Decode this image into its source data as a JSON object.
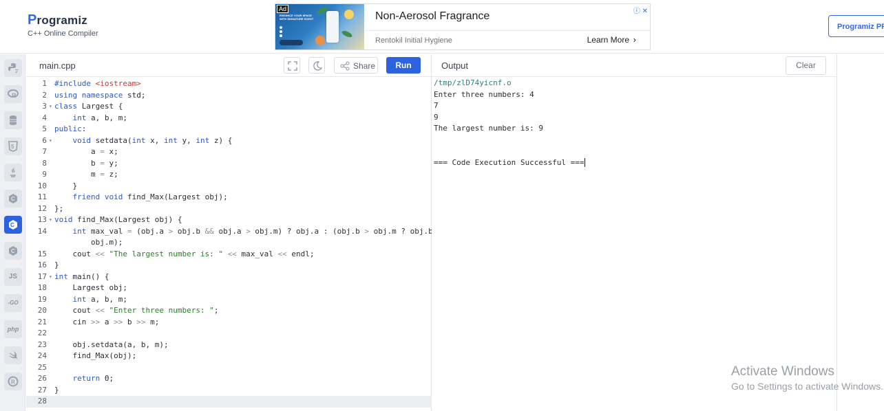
{
  "header": {
    "logo_text": "rogramiz",
    "logo_p": "P",
    "logo_subtitle": "C++ Online Compiler",
    "pro_button": "Programiz PRO"
  },
  "ad": {
    "badge": "Ad",
    "title": "Non-Aerosol Fragrance",
    "advertiser": "Rentokil Initial Hygiene",
    "cta": "Learn More",
    "cta_chevron": "›",
    "choices_icons": "ⓘ ✕",
    "image_text": "ENHANCE YOUR SPACE WITH SIGNATURE SCENT"
  },
  "sidebar": {
    "items": [
      {
        "name": "python",
        "glyph": "py"
      },
      {
        "name": "r",
        "glyph": "R"
      },
      {
        "name": "sql",
        "glyph": "db"
      },
      {
        "name": "html",
        "glyph": "5"
      },
      {
        "name": "java",
        "glyph": "java"
      },
      {
        "name": "c",
        "glyph": "C"
      },
      {
        "name": "cpp",
        "glyph": "C"
      },
      {
        "name": "csharp",
        "glyph": "C"
      },
      {
        "name": "javascript",
        "glyph": "JS"
      },
      {
        "name": "go",
        "glyph": "-GO"
      },
      {
        "name": "php",
        "glyph": "php"
      },
      {
        "name": "swift",
        "glyph": "swift"
      },
      {
        "name": "rust",
        "glyph": "R"
      }
    ],
    "active": "cpp"
  },
  "editor": {
    "filename": "main.cpp",
    "share_label": "Share",
    "run_label": "Run",
    "lines": [
      {
        "n": "1",
        "fold": "",
        "html": "<span class=\"kw\">#include</span> <span class=\"inc\">&lt;iostream&gt;</span>"
      },
      {
        "n": "2",
        "fold": "",
        "html": "<span class=\"kw\">using</span> <span class=\"kw\">namespace</span> std;"
      },
      {
        "n": "3",
        "fold": "▾",
        "html": "<span class=\"kw\">class</span> Largest {"
      },
      {
        "n": "4",
        "fold": "",
        "html": "    <span class=\"kw\">int</span> a, b, m;"
      },
      {
        "n": "5",
        "fold": "",
        "html": "<span class=\"kw\">public</span>:"
      },
      {
        "n": "6",
        "fold": "▾",
        "html": "    <span class=\"kw\">void</span> setdata(<span class=\"kw\">int</span> x, <span class=\"kw\">int</span> y, <span class=\"kw\">int</span> z) {"
      },
      {
        "n": "7",
        "fold": "",
        "html": "        a <span class=\"op\">=</span> x;"
      },
      {
        "n": "8",
        "fold": "",
        "html": "        b <span class=\"op\">=</span> y;"
      },
      {
        "n": "9",
        "fold": "",
        "html": "        m <span class=\"op\">=</span> z;"
      },
      {
        "n": "10",
        "fold": "",
        "html": "    }"
      },
      {
        "n": "11",
        "fold": "",
        "html": "    <span class=\"kw\">friend</span> <span class=\"kw\">void</span> find_Max(Largest obj);"
      },
      {
        "n": "12",
        "fold": "",
        "html": "};"
      },
      {
        "n": "13",
        "fold": "▾",
        "html": "<span class=\"kw\">void</span> find_Max(Largest obj) {"
      },
      {
        "n": "14",
        "fold": "",
        "html": "    <span class=\"kw\">int</span> max_val <span class=\"op\">=</span> (obj.a <span class=\"op\">&gt;</span> obj.b <span class=\"op\">&amp;&amp;</span> obj.a <span class=\"op\">&gt;</span> obj.m) ? obj.a : (obj.b <span class=\"op\">&gt;</span> obj.m ? obj.b :"
      },
      {
        "n": "",
        "fold": "",
        "html": "        obj.m);"
      },
      {
        "n": "15",
        "fold": "",
        "html": "    cout <span class=\"op\">&lt;&lt;</span> <span class=\"str\">\"The largest number is: \"</span> <span class=\"op\">&lt;&lt;</span> max_val <span class=\"op\">&lt;&lt;</span> endl;"
      },
      {
        "n": "16",
        "fold": "",
        "html": "}"
      },
      {
        "n": "17",
        "fold": "▾",
        "html": "<span class=\"kw\">int</span> main() {"
      },
      {
        "n": "18",
        "fold": "",
        "html": "    Largest obj;"
      },
      {
        "n": "19",
        "fold": "",
        "html": "    <span class=\"kw\">int</span> a, b, m;"
      },
      {
        "n": "20",
        "fold": "",
        "html": "    cout <span class=\"op\">&lt;&lt;</span> <span class=\"str\">\"Enter three numbers: \"</span>;"
      },
      {
        "n": "21",
        "fold": "",
        "html": "    cin <span class=\"op\">&gt;&gt;</span> a <span class=\"op\">&gt;&gt;</span> b <span class=\"op\">&gt;&gt;</span> m;"
      },
      {
        "n": "22",
        "fold": "",
        "html": ""
      },
      {
        "n": "23",
        "fold": "",
        "html": "    obj.setdata(a, b, m);"
      },
      {
        "n": "24",
        "fold": "",
        "html": "    find_Max(obj);"
      },
      {
        "n": "25",
        "fold": "",
        "html": ""
      },
      {
        "n": "26",
        "fold": "",
        "html": "    <span class=\"kw\">return</span> 0;"
      },
      {
        "n": "27",
        "fold": "",
        "html": "}"
      },
      {
        "n": "28",
        "fold": "",
        "html": ""
      }
    ],
    "current_line": "28"
  },
  "output": {
    "title": "Output",
    "clear_label": "Clear",
    "lines": [
      "/tmp/zlD74yicnf.o",
      "Enter three numbers: 4",
      "7",
      "9",
      "The largest number is: 9",
      "",
      "",
      "=== Code Execution Successful ==="
    ]
  },
  "watermark": {
    "line1": "Activate Windows",
    "line2": "Go to Settings to activate Windows."
  },
  "colors": {
    "accent": "#2e63df",
    "keyword": "#2e58c9",
    "string": "#2b7d2b",
    "include": "#c23a3a"
  }
}
